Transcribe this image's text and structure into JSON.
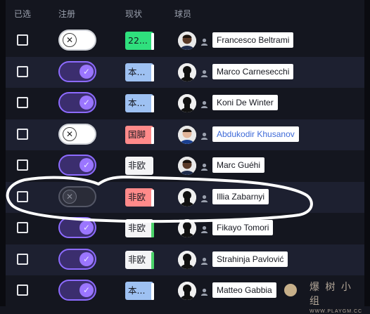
{
  "header": {
    "selected": "已选",
    "registered": "注册",
    "status": "现状",
    "player": "球员"
  },
  "colors": {
    "background": "#14161f",
    "row_alt": "#1d2030",
    "toggle_on": "#8d6bff",
    "status_green": "#2fe07d",
    "status_blue": "#9ec1f2",
    "status_red": "#ff8a8a",
    "link_blue": "#3e6ad8"
  },
  "rows": [
    {
      "registered": false,
      "status": "22...",
      "status_color": "green",
      "bar": "white",
      "player": "Francesco Beltrami",
      "avatar": "dark-skin"
    },
    {
      "registered": true,
      "status": "本...",
      "status_color": "blue",
      "bar": "white",
      "player": "Marco Carnesecchi",
      "avatar": "silhouette"
    },
    {
      "registered": true,
      "status": "本...",
      "status_color": "blue",
      "bar": "white",
      "player": "Koni De Winter",
      "avatar": "silhouette"
    },
    {
      "registered": false,
      "status": "国脚",
      "status_color": "red",
      "bar": "white",
      "player": "Abdukodir Khusanov",
      "avatar": "light-skin",
      "link": true
    },
    {
      "registered": true,
      "status": "非欧",
      "status_color": "white",
      "bar": "none",
      "player": "Marc Guéhi",
      "avatar": "dark-skin"
    },
    {
      "registered": false,
      "status": "非欧",
      "status_color": "red",
      "bar": "white",
      "player": "Illia Zabarnyi",
      "avatar": "silhouette",
      "dim": true
    },
    {
      "registered": true,
      "status": "非欧",
      "status_color": "white",
      "bar": "green",
      "player": "Fikayo Tomori",
      "avatar": "silhouette"
    },
    {
      "registered": true,
      "status": "非欧",
      "status_color": "white",
      "bar": "green",
      "player": "Strahinja Pavlović",
      "avatar": "silhouette"
    },
    {
      "registered": true,
      "status": "本...",
      "status_color": "blue",
      "bar": "white",
      "player": "Matteo Gabbia",
      "avatar": "silhouette"
    }
  ],
  "watermark": {
    "title": "爆 树 小 组",
    "url": "WWW.PLAYGM.CC"
  }
}
